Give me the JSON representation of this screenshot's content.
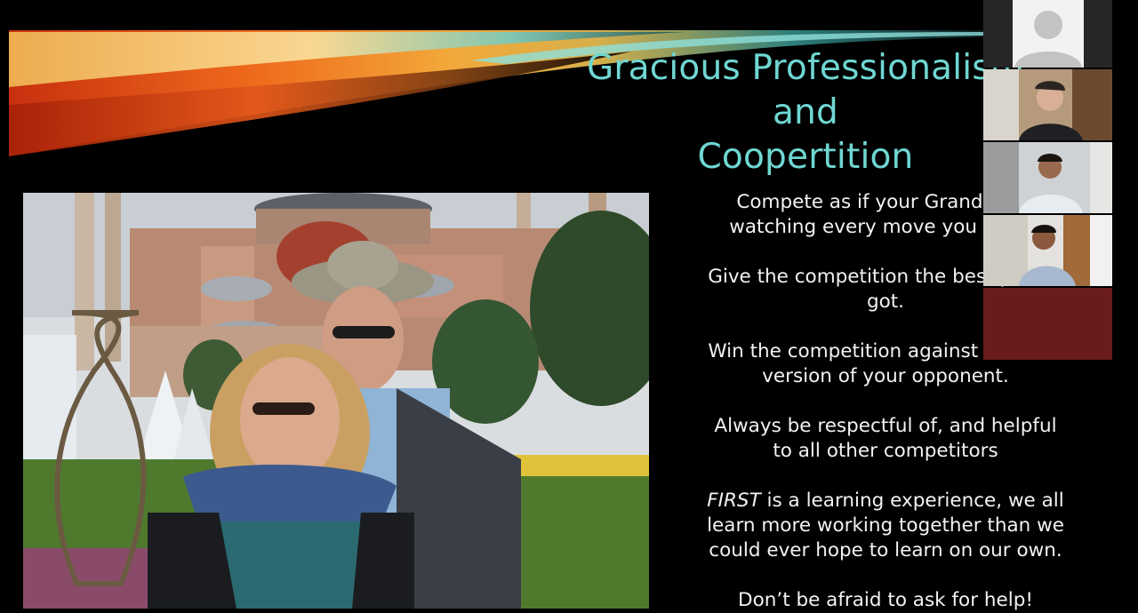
{
  "slide": {
    "title_lines": [
      "Gracious Professionalism",
      "and",
      "Coopertition"
    ],
    "paragraphs": [
      {
        "id": "p1",
        "text": "Compete as if your Grandma is\nwatching every move you make."
      },
      {
        "id": "p2",
        "text": "Give the competition the best you've\ngot."
      },
      {
        "id": "p3",
        "text": "Win the competition against the best\nversion of your opponent."
      },
      {
        "id": "p4",
        "text": "Always be respectful of, and helpful\nto all other competitors"
      },
      {
        "id": "p5",
        "first_word": "FIRST",
        "text": " is a learning experience, we all\nlearn more working together than we\ncould ever hope to learn on our own."
      },
      {
        "id": "p6",
        "text": "Don’t be afraid to ask for help!"
      }
    ],
    "photo_label": "Couple in front of Hagia Sophia"
  },
  "video_gallery": {
    "tiles": [
      {
        "name": "participant-no-video",
        "type": "avatar"
      },
      {
        "name": "participant-1",
        "type": "video"
      },
      {
        "name": "participant-2",
        "type": "video"
      },
      {
        "name": "participant-3",
        "type": "video"
      },
      {
        "name": "participant-empty",
        "type": "blank"
      }
    ]
  },
  "colors": {
    "title": "#6fd7d2",
    "background": "#000000",
    "swoosh_orange": "#e8561a",
    "swoosh_gold": "#f0b43a",
    "swoosh_teal": "#3aa3a8",
    "gallery_empty": "#6a1c1c"
  }
}
